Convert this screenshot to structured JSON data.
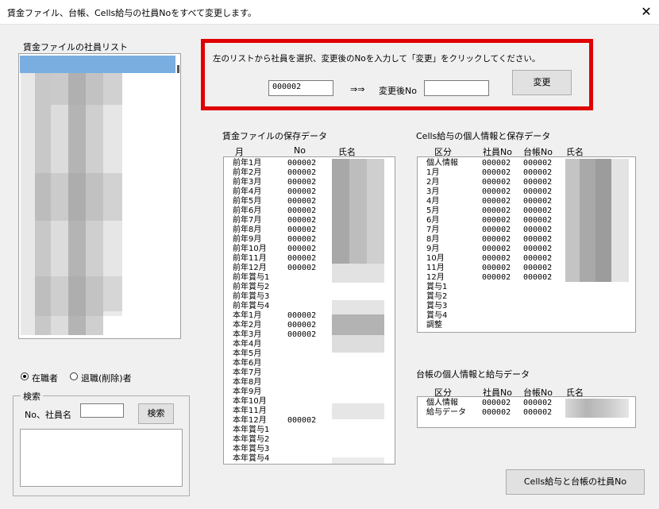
{
  "window": {
    "title": "賃金ファイル、台帳、Cells給与の社員Noをすべて変更します。",
    "close": "✕"
  },
  "left_list": {
    "label": "賃金ファイルの社員リスト"
  },
  "instruction": {
    "text": "左のリストから社員を選択、変更後のNoを入力して「変更」をクリックしてください。",
    "current_no": "000002",
    "arrow": "⇒⇒",
    "new_no_label": "変更後No",
    "new_no_value": "",
    "change_button": "変更"
  },
  "wage_data": {
    "label": "賃金ファイルの保存データ",
    "headers": [
      "月",
      "No",
      "氏名"
    ],
    "rows": [
      {
        "month": "前年1月",
        "no": "000002"
      },
      {
        "month": "前年2月",
        "no": "000002"
      },
      {
        "month": "前年3月",
        "no": "000002"
      },
      {
        "month": "前年4月",
        "no": "000002"
      },
      {
        "month": "前年5月",
        "no": "000002"
      },
      {
        "month": "前年6月",
        "no": "000002"
      },
      {
        "month": "前年7月",
        "no": "000002"
      },
      {
        "month": "前年8月",
        "no": "000002"
      },
      {
        "month": "前年9月",
        "no": "000002"
      },
      {
        "month": "前年10月",
        "no": "000002"
      },
      {
        "month": "前年11月",
        "no": "000002"
      },
      {
        "month": "前年12月",
        "no": "000002"
      },
      {
        "month": "前年賞与1",
        "no": ""
      },
      {
        "month": "前年賞与2",
        "no": ""
      },
      {
        "month": "前年賞与3",
        "no": ""
      },
      {
        "month": "前年賞与4",
        "no": ""
      },
      {
        "month": "本年1月",
        "no": "000002"
      },
      {
        "month": "本年2月",
        "no": "000002"
      },
      {
        "month": "本年3月",
        "no": "000002"
      },
      {
        "month": "本年4月",
        "no": ""
      },
      {
        "month": "本年5月",
        "no": ""
      },
      {
        "month": "本年6月",
        "no": ""
      },
      {
        "month": "本年7月",
        "no": ""
      },
      {
        "month": "本年8月",
        "no": ""
      },
      {
        "month": "本年9月",
        "no": ""
      },
      {
        "month": "本年10月",
        "no": ""
      },
      {
        "month": "本年11月",
        "no": ""
      },
      {
        "month": "本年12月",
        "no": "000002"
      },
      {
        "month": "本年賞与1",
        "no": ""
      },
      {
        "month": "本年賞与2",
        "no": ""
      },
      {
        "month": "本年賞与3",
        "no": ""
      },
      {
        "month": "本年賞与4",
        "no": ""
      }
    ]
  },
  "cells_data": {
    "label": "Cells給与の個人情報と保存データ",
    "headers": [
      "区分",
      "社員No",
      "台帳No",
      "氏名"
    ],
    "rows": [
      {
        "kubun": "個人情報",
        "emp": "000002",
        "ledger": "000002"
      },
      {
        "kubun": "1月",
        "emp": "000002",
        "ledger": "000002"
      },
      {
        "kubun": "2月",
        "emp": "000002",
        "ledger": "000002"
      },
      {
        "kubun": "3月",
        "emp": "000002",
        "ledger": "000002"
      },
      {
        "kubun": "4月",
        "emp": "000002",
        "ledger": "000002"
      },
      {
        "kubun": "5月",
        "emp": "000002",
        "ledger": "000002"
      },
      {
        "kubun": "6月",
        "emp": "000002",
        "ledger": "000002"
      },
      {
        "kubun": "7月",
        "emp": "000002",
        "ledger": "000002"
      },
      {
        "kubun": "8月",
        "emp": "000002",
        "ledger": "000002"
      },
      {
        "kubun": "9月",
        "emp": "000002",
        "ledger": "000002"
      },
      {
        "kubun": "10月",
        "emp": "000002",
        "ledger": "000002"
      },
      {
        "kubun": "11月",
        "emp": "000002",
        "ledger": "000002"
      },
      {
        "kubun": "12月",
        "emp": "000002",
        "ledger": "000002"
      },
      {
        "kubun": "賞与1",
        "emp": "",
        "ledger": ""
      },
      {
        "kubun": "賞与2",
        "emp": "",
        "ledger": ""
      },
      {
        "kubun": "賞与3",
        "emp": "",
        "ledger": ""
      },
      {
        "kubun": "賞与4",
        "emp": "",
        "ledger": ""
      },
      {
        "kubun": "調整",
        "emp": "",
        "ledger": ""
      }
    ]
  },
  "ledger_data": {
    "label": "台帳の個人情報と給与データ",
    "headers": [
      "区分",
      "社員No",
      "台帳No",
      "氏名"
    ],
    "rows": [
      {
        "kubun": "個人情報",
        "emp": "000002",
        "ledger": "000002"
      },
      {
        "kubun": "給与データ",
        "emp": "000002",
        "ledger": "000002"
      }
    ]
  },
  "filter": {
    "active_label": "在職者",
    "retired_label": "退職(削除)者",
    "selected": "active"
  },
  "search": {
    "group_label": "検索",
    "field_label": "No、社員名",
    "value": "",
    "button": "検索"
  },
  "bottom_button": "Cells給与と台帳の社員No"
}
